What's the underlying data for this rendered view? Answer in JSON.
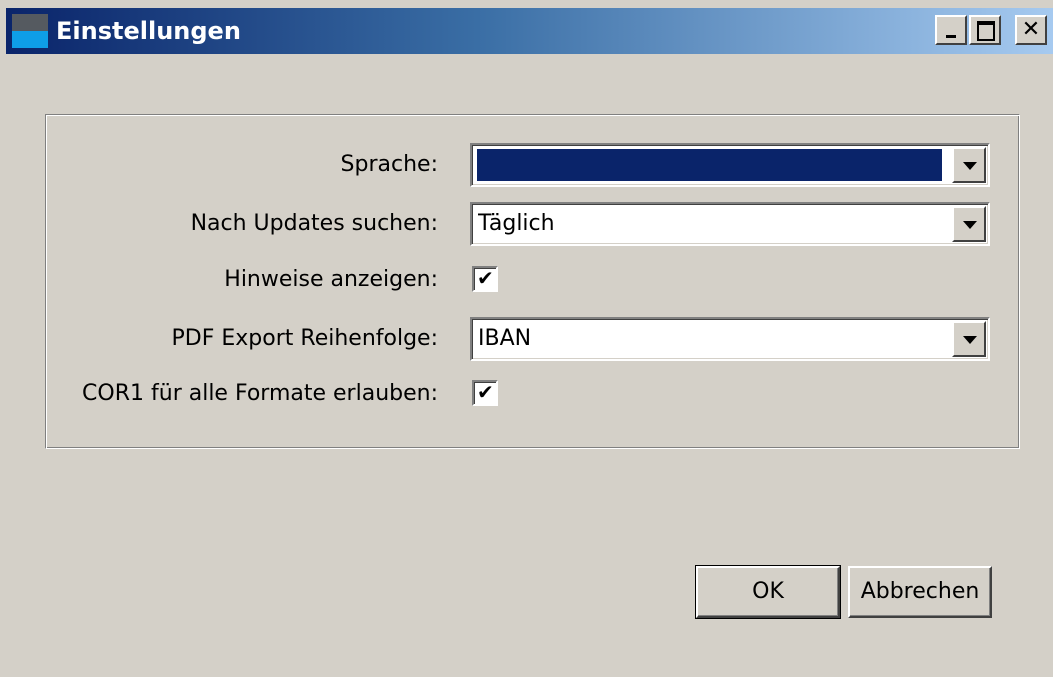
{
  "window": {
    "title": "Einstellungen",
    "controls": {
      "minimize_icon": "minimize-icon",
      "maximize_icon": "maximize-icon",
      "close_icon": "close-icon",
      "close_glyph": "✕"
    }
  },
  "settings": {
    "language": {
      "label": "Sprache:",
      "value": ""
    },
    "update_check": {
      "label": "Nach Updates suchen:",
      "value": "Täglich"
    },
    "show_hints": {
      "label": "Hinweise anzeigen:",
      "checked": true,
      "check_glyph": "✔"
    },
    "pdf_export_order": {
      "label": "PDF Export Reihenfolge:",
      "value": "IBAN"
    },
    "cor1_all_formats": {
      "label": "COR1 für alle Formate erlauben:",
      "checked": true,
      "check_glyph": "✔"
    }
  },
  "buttons": {
    "ok": "OK",
    "cancel": "Abbrechen"
  },
  "colors": {
    "titlebar_start": "#0a246a",
    "titlebar_end": "#a6caf0",
    "selection": "#0a246a",
    "face": "#d4d0c8"
  }
}
